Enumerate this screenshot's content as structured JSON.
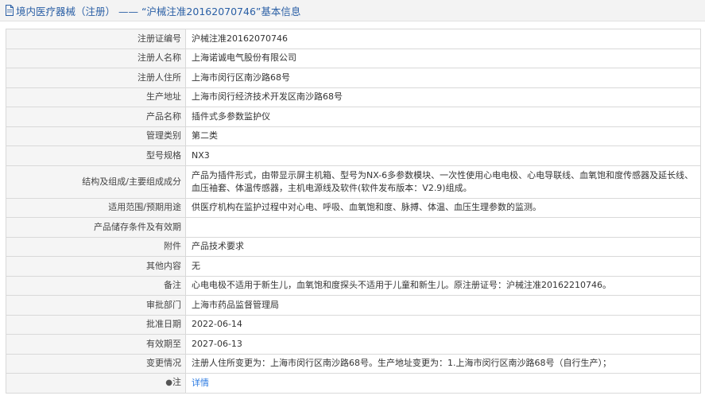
{
  "header": {
    "title": "境内医疗器械（注册） —— “沪械注准20162070746”基本信息"
  },
  "rows": [
    {
      "label": "注册证编号",
      "value": "沪械注准20162070746"
    },
    {
      "label": "注册人名称",
      "value": "上海诺诚电气股份有限公司"
    },
    {
      "label": "注册人住所",
      "value": "上海市闵行区南沙路68号"
    },
    {
      "label": "生产地址",
      "value": "上海市闵行经济技术开发区南沙路68号"
    },
    {
      "label": "产品名称",
      "value": "插件式多参数监护仪"
    },
    {
      "label": "管理类别",
      "value": "第二类"
    },
    {
      "label": "型号规格",
      "value": "NX3"
    },
    {
      "label": "结构及组成/主要组成成分",
      "value": "产品为插件形式，由带显示屏主机箱、型号为NX-6多参数模块、一次性使用心电电极、心电导联线、血氧饱和度传感器及延长线、血压袖套、体温传感器，主机电源线及软件(软件发布版本：V2.9)组成。"
    },
    {
      "label": "适用范围/预期用途",
      "value": "供医疗机构在监护过程中对心电、呼吸、血氧饱和度、脉搏、体温、血压生理参数的监测。"
    },
    {
      "label": "产品储存条件及有效期",
      "value": ""
    },
    {
      "label": "附件",
      "value": "产品技术要求"
    },
    {
      "label": "其他内容",
      "value": "无"
    },
    {
      "label": "备注",
      "value": "心电电极不适用于新生儿，血氧饱和度探头不适用于儿童和新生儿。原注册证号：沪械注准20162210746。"
    },
    {
      "label": "审批部门",
      "value": "上海市药品监督管理局"
    },
    {
      "label": "批准日期",
      "value": "2022-06-14"
    },
    {
      "label": "有效期至",
      "value": "2027-06-13"
    },
    {
      "label": "变更情况",
      "value": "注册人住所变更为：上海市闵行区南沙路68号。生产地址变更为：1.上海市闵行区南沙路68号（自行生产）；"
    }
  ],
  "note": {
    "label": "注",
    "link": "详情"
  }
}
